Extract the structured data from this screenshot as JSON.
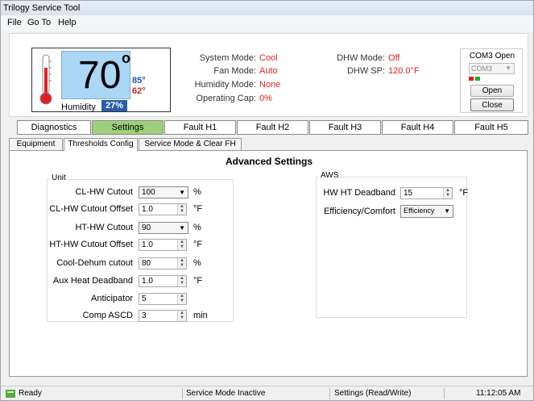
{
  "window": {
    "title": "Trilogy Service Tool"
  },
  "menu": [
    "File",
    "Go To",
    "Help"
  ],
  "thermostat": {
    "temperature": "70",
    "degree_symbol": "o",
    "high_setpoint": "85°",
    "low_setpoint": "62°",
    "humidity_label": "Humidity",
    "humidity_value": "27%"
  },
  "status": {
    "system_mode_label": "System Mode:",
    "system_mode_value": "Cool",
    "fan_mode_label": "Fan Mode:",
    "fan_mode_value": "Auto",
    "humidity_mode_label": "Humidity Mode:",
    "humidity_mode_value": "None",
    "operating_cap_label": "Operating Cap:",
    "operating_cap_value": "0%",
    "dhw_mode_label": "DHW Mode:",
    "dhw_mode_value": "Off",
    "dhw_sp_label": "DHW SP:",
    "dhw_sp_value": "120.0°F"
  },
  "com": {
    "title": "COM3 Open",
    "port": "COM3",
    "open_label": "Open",
    "close_label": "Close"
  },
  "main_tabs": [
    "Diagnostics",
    "Settings",
    "Fault H1",
    "Fault H2",
    "Fault H3",
    "Fault H4",
    "Fault H5"
  ],
  "sub_tabs": [
    "Equipment",
    "Thresholds Config",
    "Service Mode & Clear FH"
  ],
  "advanced": {
    "title": "Advanced Settings",
    "unit_group": "Unit",
    "aws_group": "AWS",
    "unit_fields": [
      {
        "label": "CL-HW Cutout",
        "value": "100",
        "unit": "%"
      },
      {
        "label": "CL-HW Cutout Offset",
        "value": "1.0",
        "unit": "°F"
      },
      {
        "label": "HT-HW Cutout",
        "value": "90",
        "unit": "%"
      },
      {
        "label": "HT-HW Cutout Offset",
        "value": "1.0",
        "unit": "°F"
      },
      {
        "label": "Cool-Dehum cutout",
        "value": "80",
        "unit": "%"
      },
      {
        "label": "Aux Heat Deadband",
        "value": "1.0",
        "unit": "°F"
      },
      {
        "label": "Anticipator",
        "value": "5",
        "unit": ""
      },
      {
        "label": "Comp ASCD",
        "value": "3",
        "unit": "min"
      }
    ],
    "aws_fields": [
      {
        "label": "HW HT Deadband",
        "value": "15",
        "unit": "°F"
      },
      {
        "label": "Efficiency/Comfort",
        "value": "Efficiency",
        "unit": ""
      }
    ]
  },
  "statusbar": {
    "ready": "Ready",
    "service_mode": "Service Mode Inactive",
    "settings_mode": "Settings (Read/Write)",
    "time": "11:12:05 AM"
  },
  "colors": {
    "lcd": "#aad7f6",
    "active_tab": "#9ed07c",
    "status_value": "#dd2222",
    "humidity_badge": "#2b5ca8"
  }
}
